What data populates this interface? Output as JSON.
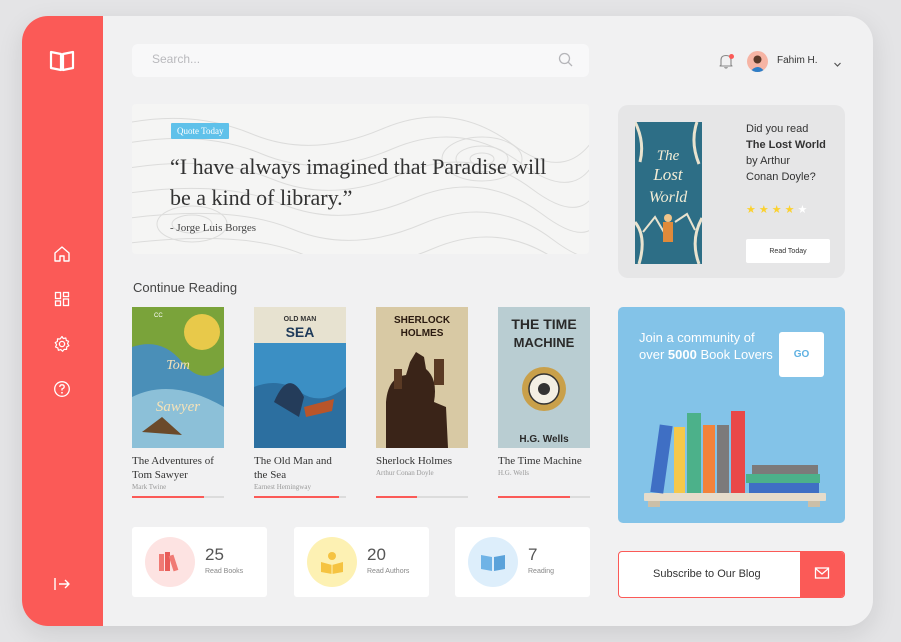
{
  "search": {
    "placeholder": "Search..."
  },
  "user": {
    "name": "Fahim H."
  },
  "quote": {
    "tag": "Quote Today",
    "text": "“I have always imagined that Paradise will be a kind of library.”",
    "author": "- Jorge Luis Borges"
  },
  "continue_reading": {
    "title": "Continue Reading",
    "books": [
      {
        "title": "The Adventures of Tom Sawyer",
        "author": "Mark Twine",
        "progress": 0.78,
        "cover_text": "SAWYER"
      },
      {
        "title": "The Old Man and the Sea",
        "author": "Earnest Hemingway",
        "progress": 0.92,
        "cover_text": "OLD MAN SEA"
      },
      {
        "title": "Sherlock Holmes",
        "author": "Arthur Conan Doyle",
        "progress": 0.45,
        "cover_text": "SHERLOCK HOLMES"
      },
      {
        "title": "The Time Machine",
        "author": "H.G. Wells",
        "progress": 0.78,
        "cover_text": "THE TIME MACHINE"
      }
    ]
  },
  "stats": [
    {
      "value": "25",
      "label": "Read Books",
      "icon": "books-icon",
      "color": "#fde3e2"
    },
    {
      "value": "20",
      "label": "Read Authors",
      "icon": "reader-icon",
      "color": "#fdf1b3"
    },
    {
      "value": "7",
      "label": "Reading",
      "icon": "open-book-icon",
      "color": "#ddeefb"
    }
  ],
  "recommendation": {
    "line1": "Did you read",
    "book_title": "The Lost World",
    "line3": "by Arthur",
    "line4": "Conan Doyle?",
    "rating": 4,
    "max_rating": 5,
    "button": "Read Today",
    "cover_title": "The Lost World",
    "cover_author": "Arthur Conan Doyle"
  },
  "community": {
    "text_a": "Join a community of over",
    "number": "5000",
    "text_b": "Book Lovers",
    "button": "GO"
  },
  "subscribe": {
    "label": "Subscribe to Our Blog"
  },
  "colors": {
    "accent": "#fb5a57",
    "sky": "#83c3e8",
    "tag": "#5fc1ea",
    "star": "#fbd12f"
  }
}
